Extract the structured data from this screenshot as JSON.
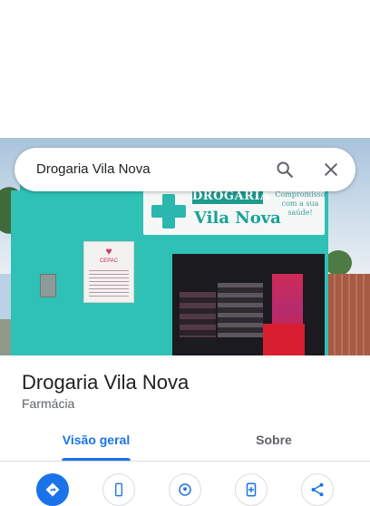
{
  "search": {
    "query": "Drogaria Vila Nova"
  },
  "photo": {
    "sign_top": "DROGARIA",
    "sign_main": "Vila Nova",
    "slogan": "Compromisso com a sua saúde!",
    "poster_title": "CEPAC"
  },
  "place": {
    "name": "Drogaria Vila Nova",
    "category": "Farmácia"
  },
  "tabs": [
    {
      "label": "Visão geral",
      "active": true
    },
    {
      "label": "Sobre",
      "active": false
    }
  ],
  "actions": [
    {
      "icon": "directions-icon"
    },
    {
      "icon": "phone-icon"
    },
    {
      "icon": "location-icon"
    },
    {
      "icon": "save-icon"
    },
    {
      "icon": "share-icon"
    }
  ],
  "colors": {
    "accent": "#1a73e8",
    "text_primary": "#202124",
    "text_secondary": "#5f6368"
  }
}
